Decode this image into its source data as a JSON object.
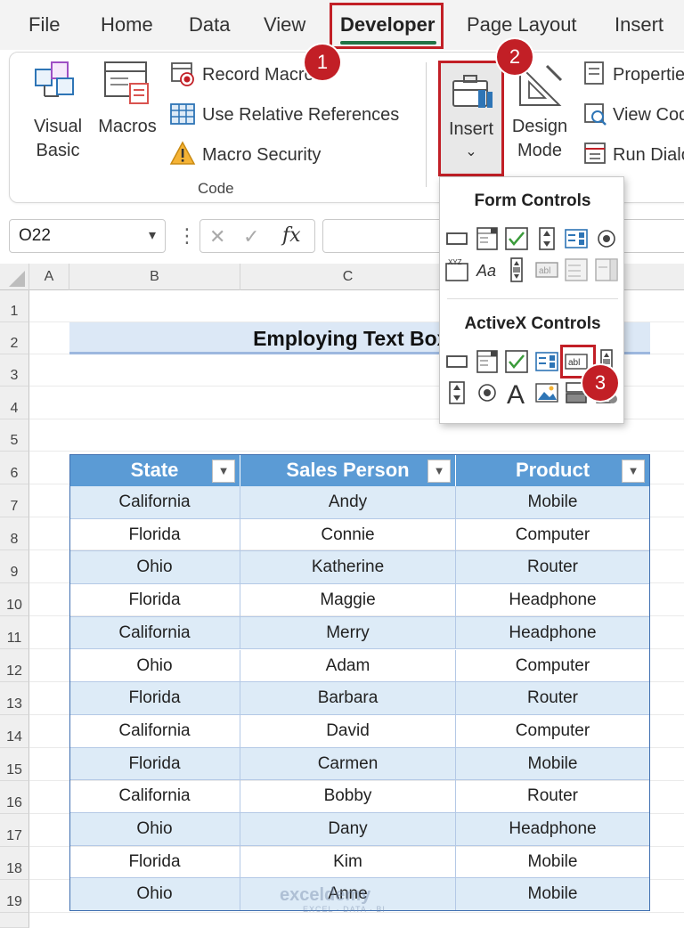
{
  "ribbon": {
    "tabs": [
      {
        "label": "File"
      },
      {
        "label": "Home"
      },
      {
        "label": "Data"
      },
      {
        "label": "View"
      },
      {
        "label": "Developer",
        "active": true
      },
      {
        "label": "Page Layout"
      },
      {
        "label": "Insert"
      }
    ],
    "code_group": {
      "visual_basic_line1": "Visual",
      "visual_basic_line2": "Basic",
      "macros": "Macros",
      "record_macro": "Record Macro",
      "use_relative_references": "Use Relative References",
      "macro_security": "Macro Security",
      "group_label": "Code"
    },
    "controls_group": {
      "insert": "Insert",
      "insert_arrow": "⌄",
      "design_mode_line1": "Design",
      "design_mode_line2": "Mode",
      "properties": "Properties",
      "view_code": "View Code",
      "run_dialog": "Run Dialog"
    }
  },
  "callouts": {
    "step1": "1",
    "step2": "2",
    "step3": "3"
  },
  "accent_colors": {
    "excel_green": "#217346",
    "highlight_red": "#c21f26",
    "table_header": "#5b9bd5",
    "table_band": "#ddebf7",
    "title_fill": "#dce8f6"
  },
  "formula_bar": {
    "name_box": "O22",
    "cancel_icon": "✕",
    "enter_icon": "✓",
    "fx_label": "fx",
    "value": ""
  },
  "insert_dropdown": {
    "form_controls_heading": "Form Controls",
    "activex_controls_heading": "ActiveX Controls",
    "form_controls_icons": [
      "button-icon",
      "combo-box-icon",
      "check-box-icon",
      "spin-button-icon",
      "list-box-icon",
      "option-button-icon",
      "group-box-icon",
      "label-icon",
      "scroll-bar-icon",
      "text-field-icon",
      "combo-list-edit-icon",
      "combo-drop-down-icon"
    ],
    "activex_controls_icons": [
      "command-button-icon",
      "combo-box-icon",
      "check-box-icon",
      "list-box-icon",
      "text-box-icon",
      "scroll-bar-icon",
      "spin-button-icon",
      "option-button-icon",
      "label-icon",
      "image-icon",
      "toggle-button-icon",
      "more-controls-icon"
    ]
  },
  "sheet": {
    "columns": [
      "A",
      "B",
      "C"
    ],
    "rows": [
      "1",
      "2",
      "3",
      "4",
      "5",
      "6",
      "7",
      "8",
      "9",
      "10",
      "11",
      "12",
      "13",
      "14",
      "15",
      "16",
      "17",
      "18",
      "19"
    ],
    "title": "Employing Text Box F",
    "table": {
      "headers": [
        "State",
        "Sales Person",
        "Product"
      ],
      "rows": [
        [
          "California",
          "Andy",
          "Mobile"
        ],
        [
          "Florida",
          "Connie",
          "Computer"
        ],
        [
          "Ohio",
          "Katherine",
          "Router"
        ],
        [
          "Florida",
          "Maggie",
          "Headphone"
        ],
        [
          "California",
          "Merry",
          "Headphone"
        ],
        [
          "Ohio",
          "Adam",
          "Computer"
        ],
        [
          "Florida",
          "Barbara",
          "Router"
        ],
        [
          "California",
          "David",
          "Computer"
        ],
        [
          "Florida",
          "Carmen",
          "Mobile"
        ],
        [
          "California",
          "Bobby",
          "Router"
        ],
        [
          "Ohio",
          "Dany",
          "Headphone"
        ],
        [
          "Florida",
          "Kim",
          "Mobile"
        ],
        [
          "Ohio",
          "Anne",
          "Mobile"
        ]
      ]
    }
  },
  "watermark": {
    "brand": "exceldemy",
    "tagline": "EXCEL · DATA · BI"
  }
}
